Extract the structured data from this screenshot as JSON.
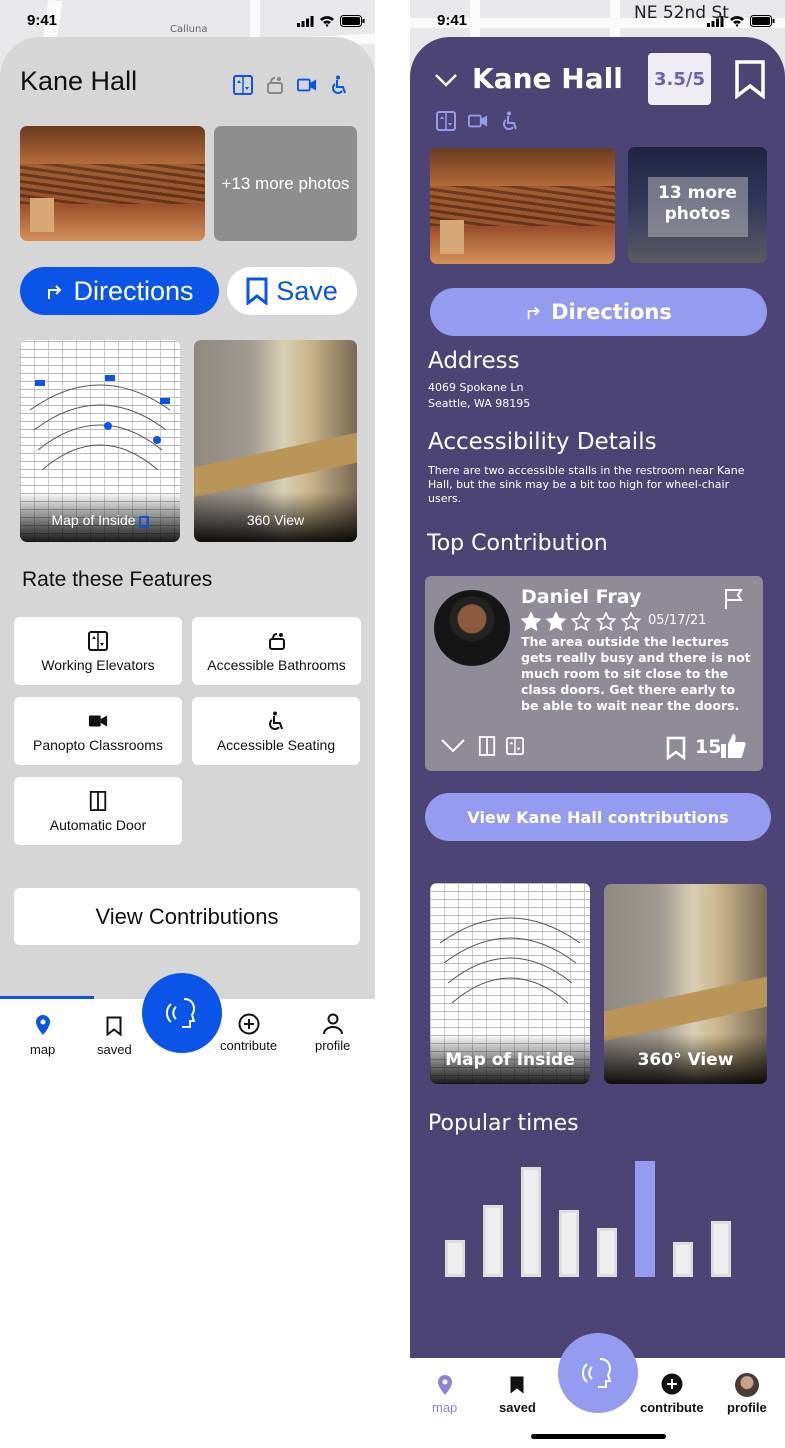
{
  "status": {
    "time": "9:41"
  },
  "left": {
    "map_street": "Calluna",
    "title": "Kane Hall",
    "more_photos": "+13 more photos",
    "directions": "Directions",
    "save": "Save",
    "map_inside": "Map of Inside",
    "view360": "360 View",
    "rate_heading": "Rate these Features",
    "features": [
      "Working Elevators",
      "Accessible Bathrooms",
      "Panopto Classrooms",
      "Accessible Seating",
      "Automatic Door"
    ],
    "view_contributions": "View Contributions",
    "nav": [
      "map",
      "saved",
      "contribute",
      "profile"
    ],
    "accent": "#0a55e8"
  },
  "right": {
    "map_street": "NE 52nd St",
    "title": "Kane Hall",
    "rating": "3.5/5",
    "more_photos": "13 more photos",
    "directions": "Directions",
    "address_heading": "Address",
    "address_line1": "4069 Spokane Ln",
    "address_line2": "Seattle, WA 98195",
    "access_heading": "Accessibility Details",
    "access_text": "There are two accessible stalls in the restroom near Kane Hall, but the sink may be a bit too high for wheel-chair users.",
    "contrib_heading": "Top Contribution",
    "contrib": {
      "name": "Daniel Fray",
      "date": "05/17/21",
      "stars": 2,
      "text": "The area outside the lectures gets really busy and there is not much room to sit close to the class doors. Get there early to be able to wait near the doors.",
      "likes": "15"
    },
    "view_contrib": "View Kane Hall contributions",
    "map_inside": "Map of Inside",
    "view360": "360° View",
    "popular_heading": "Popular times",
    "popular_levels": [
      0.32,
      0.62,
      0.95,
      0.58,
      0.42,
      1.0,
      0.3,
      0.48
    ],
    "popular_highlight_index": 5,
    "nav": [
      "map",
      "saved",
      "contribute",
      "profile"
    ],
    "accent": "#4b4474",
    "highlight": "#959bef"
  }
}
